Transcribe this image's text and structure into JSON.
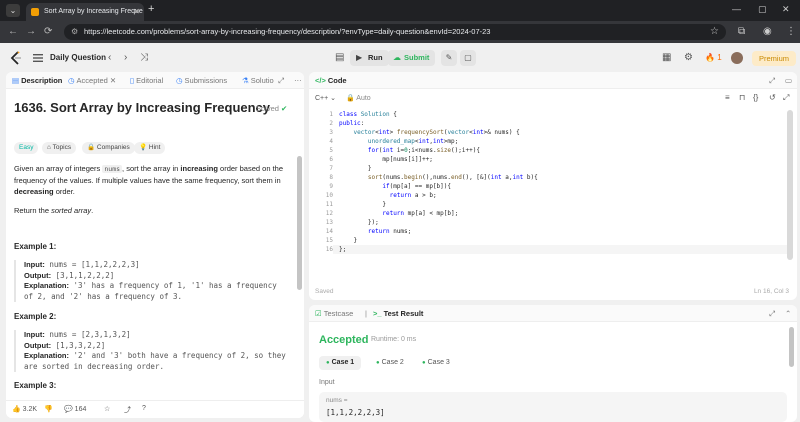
{
  "browser": {
    "tab_title": "Sort Array by Increasing Freque",
    "url": "https://leetcode.com/problems/sort-array-by-increasing-frequency/description/?envType=daily-question&envId=2024-07-23"
  },
  "header": {
    "daily_label": "Daily Question",
    "run_label": "Run",
    "submit_label": "Submit",
    "streak": "1",
    "premium_label": "Premium"
  },
  "left_panel": {
    "tabs": [
      "Description",
      "Accepted",
      "Editorial",
      "Submissions",
      "Solutio"
    ],
    "title": "1636. Sort Array by Increasing Frequency",
    "status": "Solved",
    "pills": [
      "Easy",
      "Topics",
      "Companies",
      "Hint"
    ],
    "desc1": "Given an array of integers",
    "desc_code": "nums",
    "desc2": ", sort the array in",
    "desc_bold1": "increasing",
    "desc3": "order based on the frequency of the values. If multiple values have the same frequency, sort them in",
    "desc_bold2": "decreasing",
    "desc4": "order.",
    "return_prefix": "Return the",
    "return_em": "sorted array",
    "return_suffix": ".",
    "examples": [
      {
        "heading": "Example 1:",
        "input": "nums = [1,1,2,2,2,3]",
        "output": "[3,1,1,2,2,2]",
        "explanation": "'3' has a frequency of 1, '1' has a frequency of 2, and '2' has a frequency of 3."
      },
      {
        "heading": "Example 2:",
        "input": "nums = [2,3,1,3,2]",
        "output": "[1,3,3,2,2]",
        "explanation": "'2' and '3' both have a frequency of 2, so they are sorted in decreasing order."
      },
      {
        "heading": "Example 3:"
      }
    ],
    "labels": {
      "input": "Input:",
      "output": "Output:",
      "explanation": "Explanation:"
    },
    "footer": {
      "likes": "3.2K",
      "comments": "164"
    }
  },
  "code_panel": {
    "title": "Code",
    "language": "C++",
    "mode": "Auto",
    "saved": "Saved",
    "cursor": "Ln 16, Col 3",
    "lines": [
      "class Solution {",
      "public:",
      "    vector<int> frequencySort(vector<int>& nums) {",
      "        unordered_map<int,int>mp;",
      "        for(int i=0;i<nums.size();i++){",
      "            mp[nums[i]]++;",
      "        }",
      "        sort(nums.begin(),nums.end(), [&](int a,int b){",
      "            if(mp[a] == mp[b]){",
      "              return a > b;",
      "            }",
      "            return mp[a] < mp[b];",
      "        });",
      "        return nums;",
      "    }",
      "};"
    ]
  },
  "result_panel": {
    "tabs": [
      "Testcase",
      "Test Result"
    ],
    "status": "Accepted",
    "runtime": "Runtime: 0 ms",
    "cases": [
      "Case 1",
      "Case 2",
      "Case 3"
    ],
    "input_label": "Input",
    "input_name": "nums =",
    "input_value": "[1,1,2,2,2,3]"
  }
}
